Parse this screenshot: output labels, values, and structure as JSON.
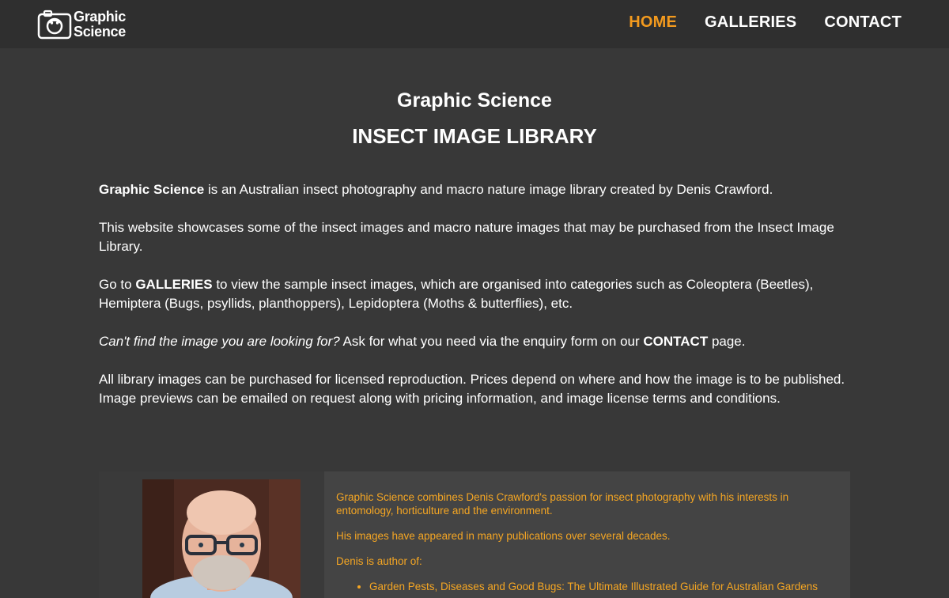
{
  "header": {
    "logo_line1": "Graphic",
    "logo_line2": "Science",
    "nav": [
      {
        "label": "HOME",
        "active": true
      },
      {
        "label": "GALLERIES",
        "active": false
      },
      {
        "label": "CONTACT",
        "active": false
      }
    ]
  },
  "hero": {
    "title": "Graphic Science",
    "subtitle": "INSECT IMAGE LIBRARY"
  },
  "intro": {
    "p1_bold": "Graphic Science",
    "p1_rest": " is an Australian insect photography and macro nature image library created by Denis Crawford.",
    "p2": "This website showcases some of the insect images and macro nature images that may be purchased from the Insect Image Library.",
    "p3_before": "Go to ",
    "p3_bold": "GALLERIES",
    "p3_after": " to view the sample insect images, which are organised into categories such as Coleoptera (Beetles), Hemiptera (Bugs, psyllids, planthoppers), Lepidoptera (Moths & butterflies), etc.",
    "p4_italic": "Can't find the image you are looking for?",
    "p4_middle": " Ask for what you need via the enquiry form on our ",
    "p4_bold": "CONTACT",
    "p4_after": " page.",
    "p5": "All library images can be purchased for licensed reproduction. Prices depend on where and how the image is to be published. Image previews can be emailed on request along with pricing information, and image license terms and conditions."
  },
  "about": {
    "p1": "Graphic Science combines Denis Crawford's passion for insect photography with his interests in entomology, horticulture and the environment.",
    "p2": "His images have appeared in many publications over several decades.",
    "p3": "Denis is author of:",
    "book1": "Garden Pests, Diseases and Good Bugs: The Ultimate Illustrated Guide for Australian Gardens"
  },
  "colors": {
    "accent": "#f39a1e",
    "background": "#383838",
    "header_bg": "#2f2f2f",
    "about_text": "#f5a623"
  }
}
